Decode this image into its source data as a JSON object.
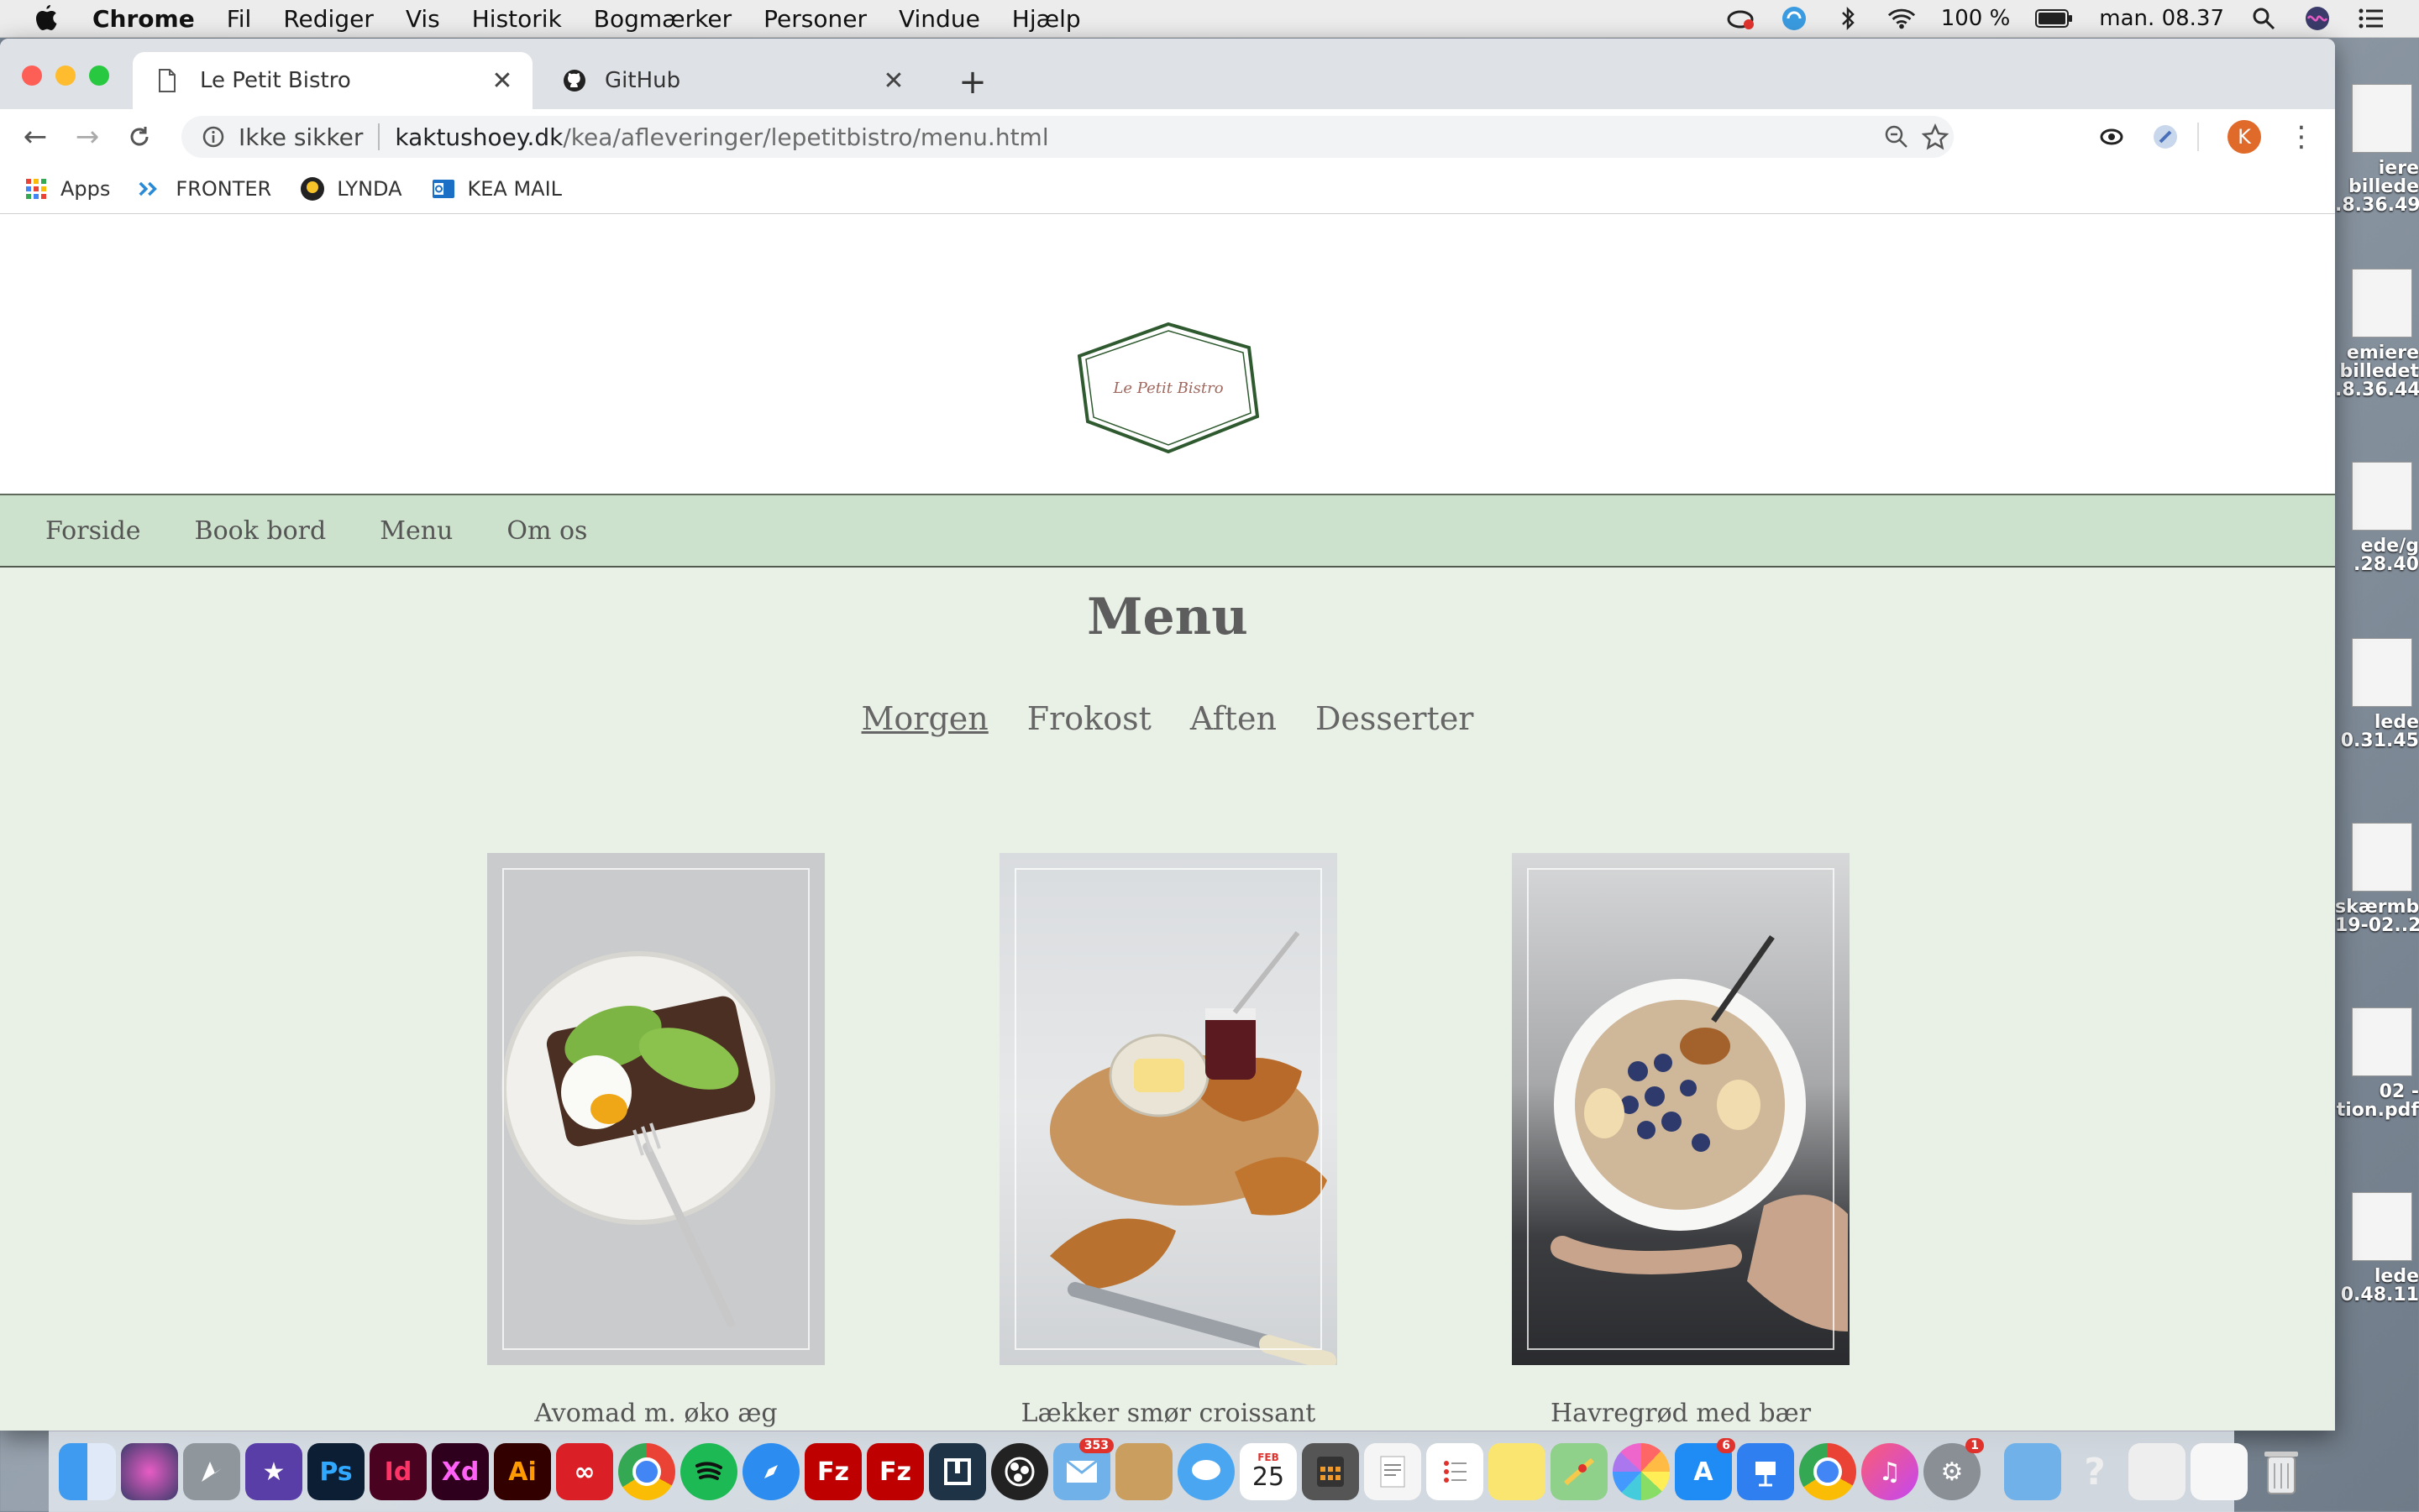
{
  "menubar": {
    "app": "Chrome",
    "items": [
      "Fil",
      "Rediger",
      "Vis",
      "Historik",
      "Bogmærker",
      "Personer",
      "Vindue",
      "Hjælp"
    ],
    "battery": "100 %",
    "clock": "man. 08.37"
  },
  "browser": {
    "tabs": [
      {
        "label": "Le Petit Bistro",
        "icon": "document-icon",
        "active": true
      },
      {
        "label": "GitHub",
        "icon": "github-icon",
        "active": false
      }
    ],
    "security_label": "Ikke sikker",
    "url_domain": "kaktushoey.dk",
    "url_path": "/kea/afleveringer/lepetitbistro/menu.html",
    "profile_initial": "K",
    "bookmarks": [
      {
        "label": "Apps",
        "icon": "apps-grid-icon"
      },
      {
        "label": "FRONTER",
        "icon": "fronter-icon"
      },
      {
        "label": "LYNDA",
        "icon": "lynda-icon"
      },
      {
        "label": "KEA MAIL",
        "icon": "outlook-icon"
      }
    ]
  },
  "site": {
    "logo_text": "Le Petit Bistro",
    "nav": [
      "Forside",
      "Book bord",
      "Menu",
      "Om os"
    ],
    "page_title": "Menu",
    "menu_tabs": [
      "Morgen",
      "Frokost",
      "Aften",
      "Desserter"
    ],
    "active_menu_tab": "Morgen",
    "dishes": [
      {
        "name": "Avomad m. øko æg",
        "image": "avocado-toast-egg"
      },
      {
        "name": "Lækker smør croissant",
        "image": "croissants-jam"
      },
      {
        "name": "Havregrød med bær",
        "image": "oatmeal-berries"
      }
    ]
  },
  "desktop": {
    "items": [
      "iere\nbillede\n.8.36.49",
      "emiere\nbilledet\n.8.36.44",
      "ede/g\n.28.40",
      "lede\n0.31.45",
      "skærmbi\n19-02..2",
      "02 -\ntion.pdf",
      "lede\n0.48.11"
    ]
  },
  "dock": {
    "apps": [
      "Finder",
      "Siri",
      "Launchpad",
      "iMovie",
      "Ps",
      "Id",
      "Xd",
      "Ai",
      "Creative Cloud",
      "Chrome",
      "Spotify",
      "Safari",
      "FileZilla",
      "FileZilla",
      "Navigator",
      "OBS",
      "Mail",
      "Notes",
      "Messages",
      "Calendar",
      "Calculator",
      "TextEdit",
      "Reminders",
      "Stickies",
      "Maps",
      "Photos",
      "App Store",
      "Keynote",
      "Chrome",
      "iTunes",
      "System Preferences"
    ],
    "calendar_day": "25",
    "calendar_month": "FEB",
    "mail_badge": "353",
    "appstore_badge": "6",
    "prefs_badge": "1"
  },
  "colors": {
    "nav_bg": "#cde2cc",
    "page_bg": "#e9f1e7",
    "logo_green": "#2f5a2f"
  }
}
